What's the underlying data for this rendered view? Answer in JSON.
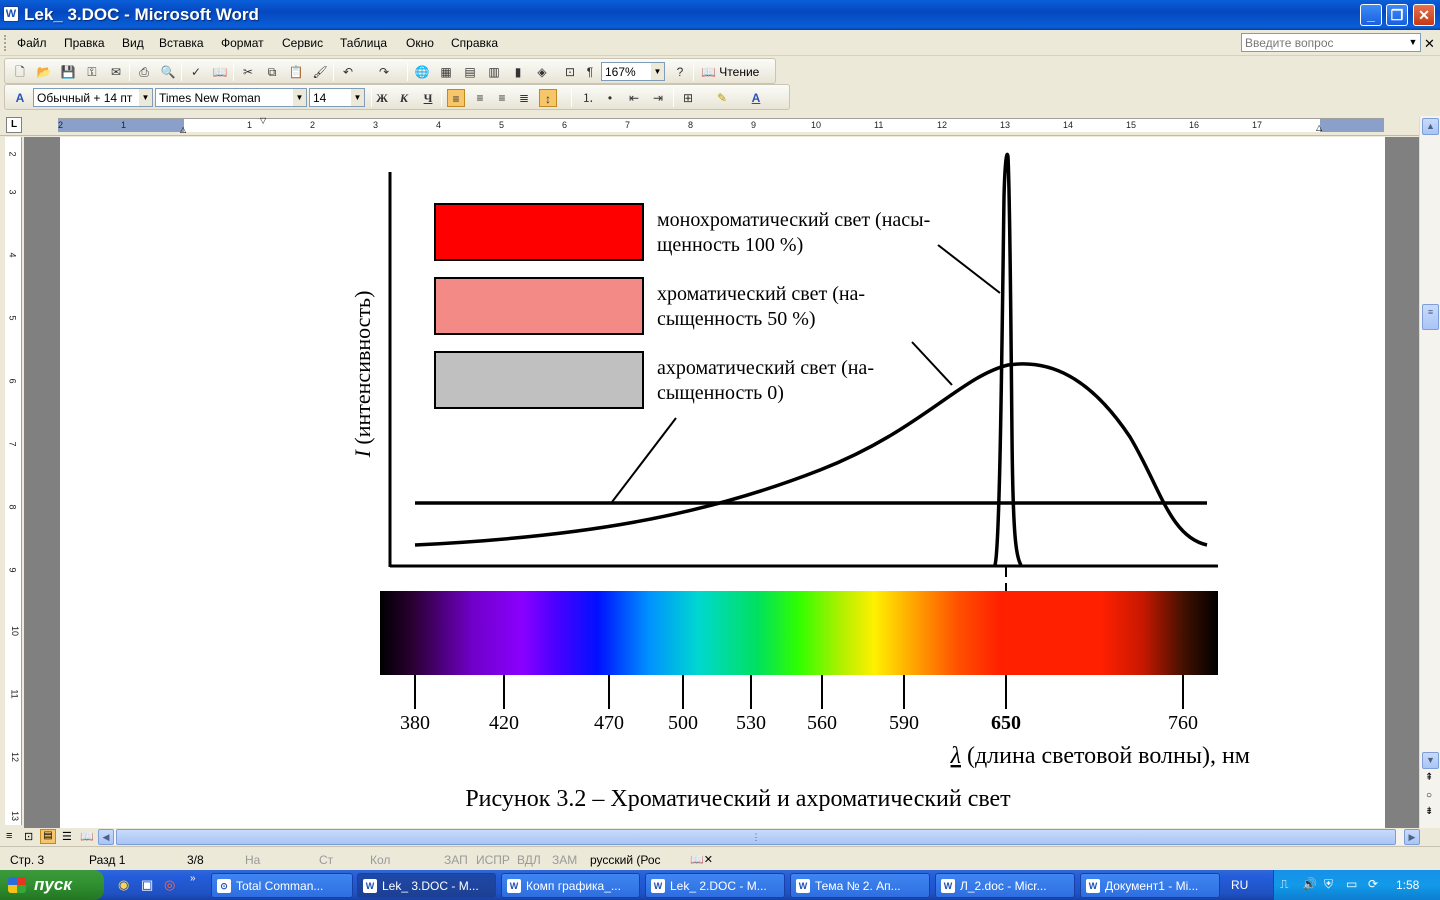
{
  "window": {
    "title": "Lek_ 3.DOC - Microsoft Word",
    "icon": "word-doc-icon"
  },
  "menu": [
    "Файл",
    "Правка",
    "Вид",
    "Вставка",
    "Формат",
    "Сервис",
    "Таблица",
    "Окно",
    "Справка"
  ],
  "ask_placeholder": "Введите вопрос",
  "standard_toolbar": {
    "zoom": "167%",
    "reading_label": "Чтение"
  },
  "format_toolbar": {
    "style": "Обычный + 14 пт",
    "font": "Times New Roman",
    "size": "14",
    "bold": "Ж",
    "italic": "К",
    "underline": "Ч"
  },
  "ruler": {
    "h_numbers": [
      "2",
      "1",
      "1",
      "2",
      "3",
      "4",
      "5",
      "6",
      "7",
      "8",
      "9",
      "10",
      "11",
      "12",
      "13",
      "14",
      "15",
      "16",
      "17"
    ],
    "v_numbers": [
      "2",
      "3",
      "4",
      "5",
      "6",
      "7",
      "8",
      "9",
      "10",
      "11",
      "12",
      "13"
    ]
  },
  "figure": {
    "y_axis_label_italic": "I",
    "y_axis_label": " (интенсивность)",
    "legend": [
      {
        "color": "#ff0000",
        "line1": "монохроматический свет (насы-",
        "line2": "щенность 100 %)"
      },
      {
        "color": "#f48a86",
        "line1": "хроматический свет (на-",
        "line2": "сыщенность 50 %)"
      },
      {
        "color": "#c0c0c0",
        "line1": "ахроматический свет (на-",
        "line2": "сыщенность 0)"
      }
    ],
    "ticks": [
      "380",
      "420",
      "470",
      "500",
      "530",
      "560",
      "590",
      "650",
      "760"
    ],
    "x_axis_lambda": "λ",
    "x_axis_label": " (длина световой волны), нм",
    "caption": "Рисунок 3.2 – Хроматический и ахроматический свет"
  },
  "status": {
    "page": "Стр. 3",
    "section": "Разд 1",
    "pages": "3/8",
    "at": "На",
    "line": "Ст",
    "col": "Кол",
    "rec": "ЗАП",
    "trk": "ИСПР",
    "ext": "ВДЛ",
    "ovr": "ЗАМ",
    "lang": "русский (Рос"
  },
  "taskbar": {
    "start": "пуск",
    "tasks": [
      "Total Comman...",
      "Lek_ 3.DOC - M...",
      "Комп графика_...",
      "Lek_ 2.DOC - M...",
      "Тема № 2. Ап...",
      "Л_2.doc - Micr...",
      "Документ1 - Mi..."
    ],
    "lang": "RU",
    "clock": "1:58"
  }
}
